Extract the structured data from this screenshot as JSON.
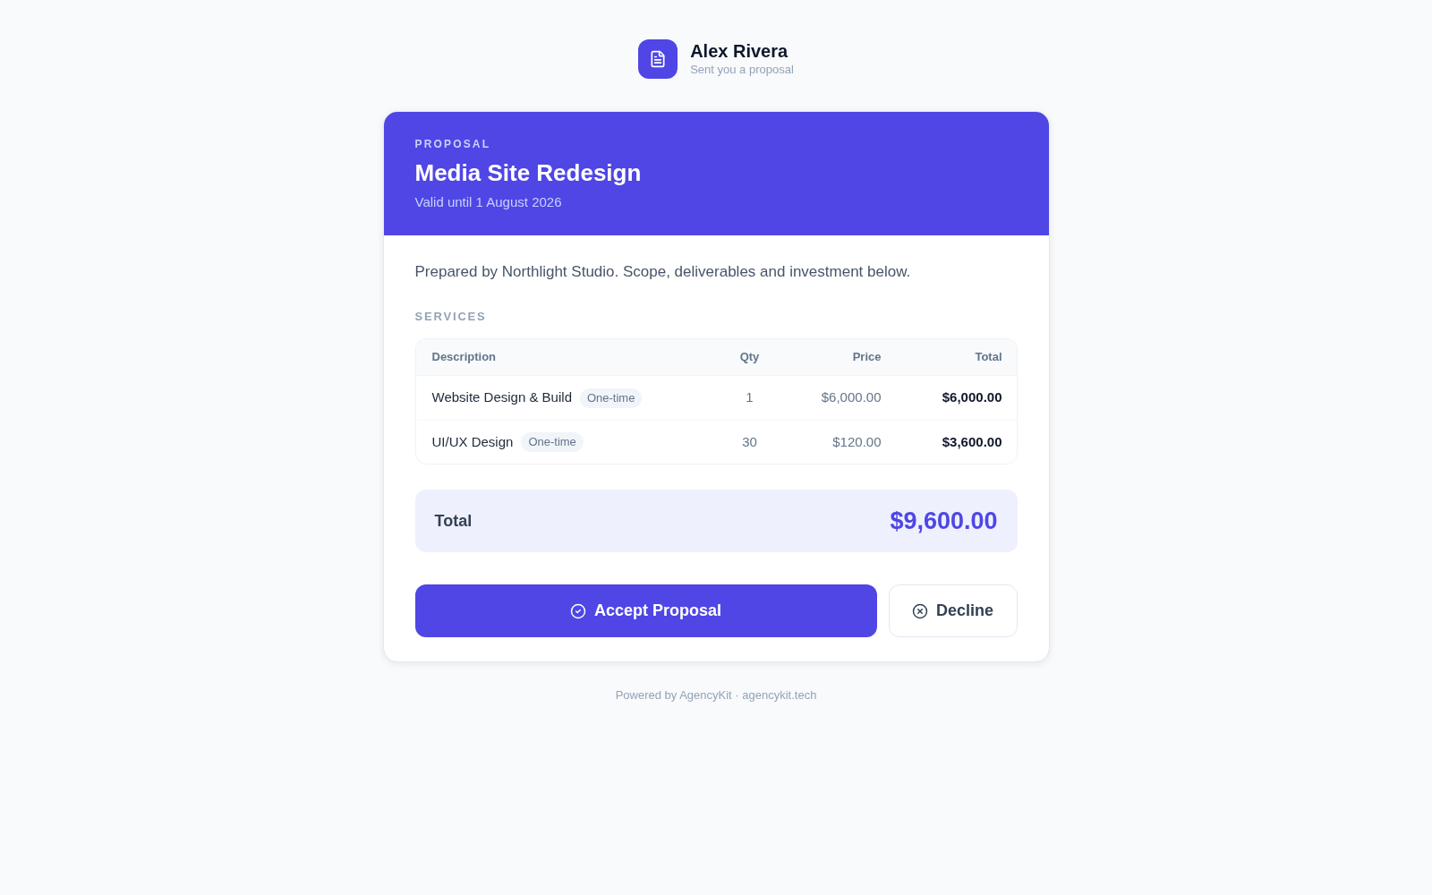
{
  "sender": {
    "name": "Alex Rivera",
    "subtitle": "Sent you a proposal"
  },
  "proposal": {
    "eyebrow": "PROPOSAL",
    "title": "Media Site Redesign",
    "validity": "Valid until 1 August 2026"
  },
  "intro": "Prepared by Northlight Studio. Scope, deliverables and investment below.",
  "services": {
    "heading": "SERVICES",
    "columns": [
      "Description",
      "Qty",
      "Price",
      "Total"
    ],
    "rows": [
      {
        "description": "Website Design & Build",
        "tag": "One-time",
        "qty": "1",
        "price": "$6,000.00",
        "total": "$6,000.00"
      },
      {
        "description": "UI/UX Design",
        "tag": "One-time",
        "qty": "30",
        "price": "$120.00",
        "total": "$3,600.00"
      }
    ]
  },
  "total": {
    "label": "Total",
    "amount": "$9,600.00"
  },
  "actions": [
    {
      "kind": "accept",
      "label": "Accept Proposal"
    },
    {
      "kind": "decline",
      "label": "Decline"
    }
  ],
  "footer": "Powered by AgencyKit · agencykit.tech"
}
